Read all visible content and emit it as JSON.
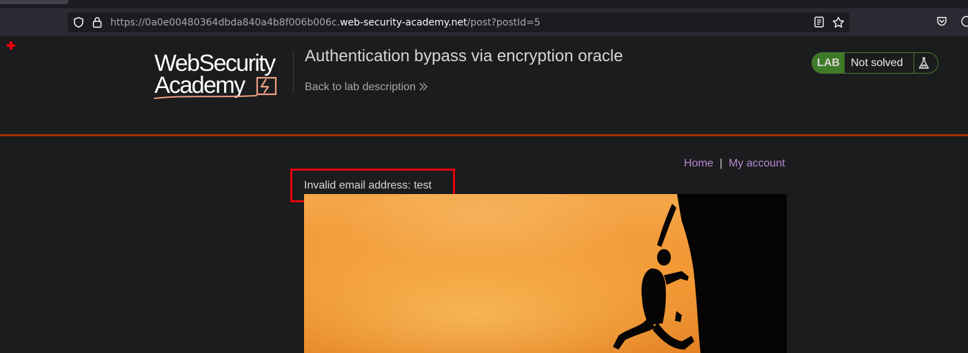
{
  "browser": {
    "url_prefix": "https://0a0e00480364dbda840a4b8f006b006c.",
    "url_host": "web-security-academy.net",
    "url_path": "/post?postId=5"
  },
  "header": {
    "logo_line1": "WebSecurity",
    "logo_line2": "Academy",
    "lab_title": "Authentication bypass via encryption oracle",
    "back_link": "Back to lab description",
    "lab_badge": "LAB",
    "lab_status": "Not solved"
  },
  "nav": {
    "home": "Home",
    "separator": "|",
    "my_account": "My account"
  },
  "message": {
    "error": "Invalid email address: test"
  },
  "colors": {
    "page_bg": "#1b1c1e",
    "accent_orange": "#a72f00",
    "link_purple": "#b88ad3",
    "lab_green": "#3f7a27",
    "highlight_red": "#e8000b"
  },
  "icons": {
    "security": "shield-icon",
    "lock": "lock-icon",
    "reader": "reader-view-icon",
    "bookmark": "star-icon",
    "pocket": "pocket-icon",
    "account": "account-icon",
    "back": "double-chevron-right-icon",
    "lab": "flask-icon"
  }
}
